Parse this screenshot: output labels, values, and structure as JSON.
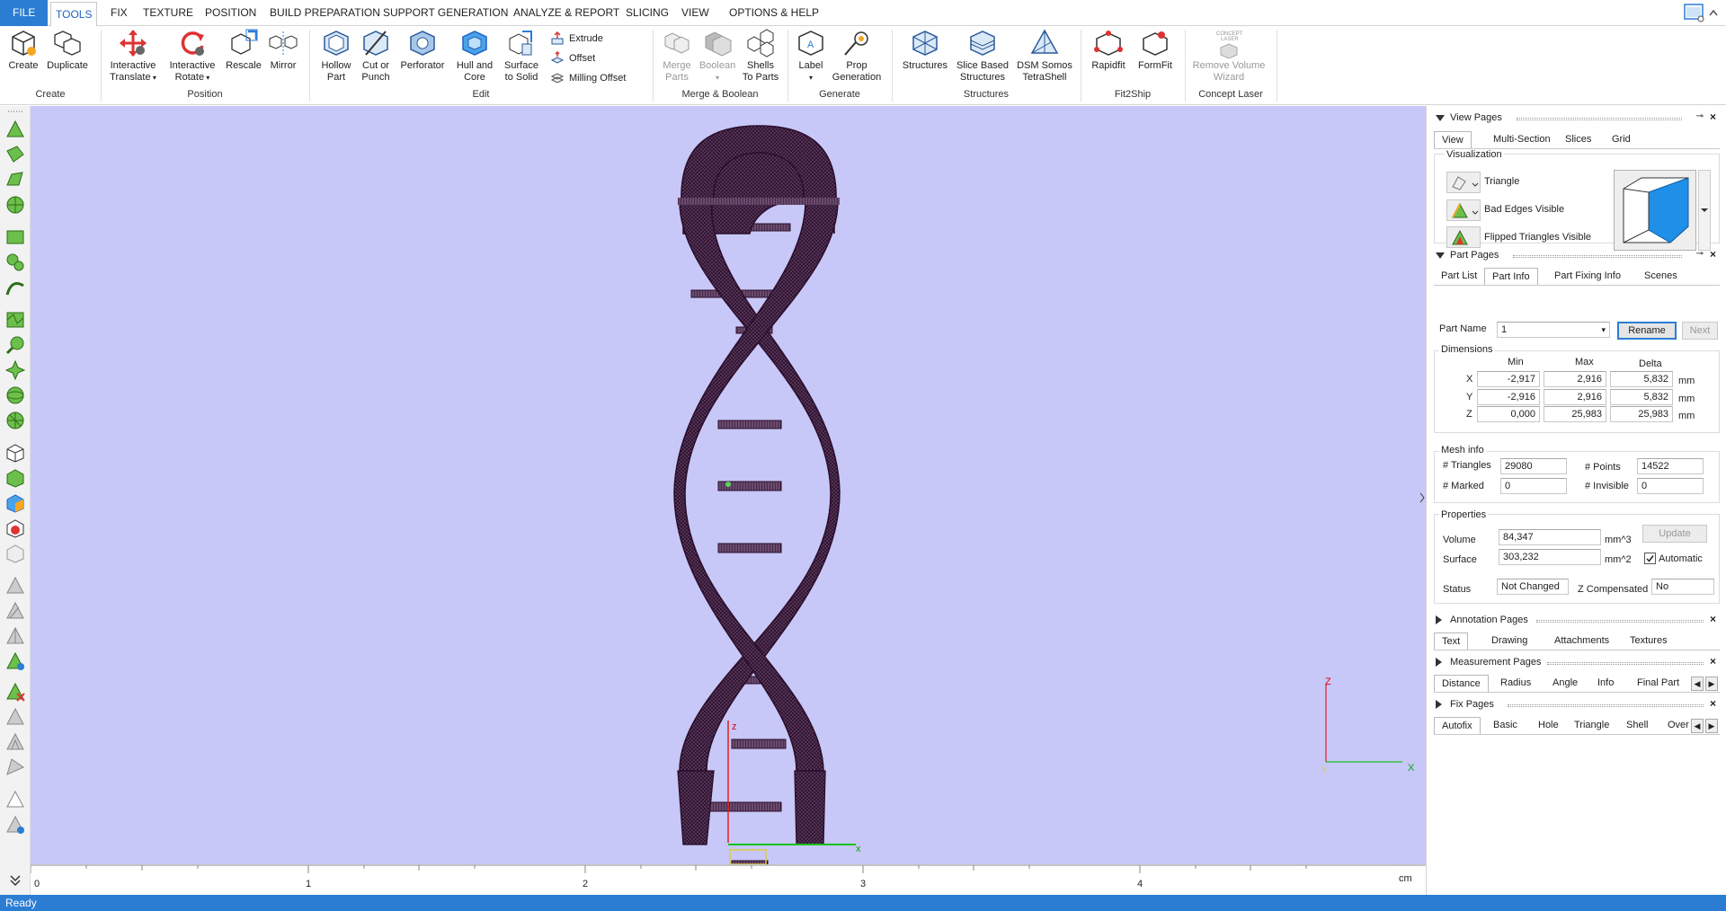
{
  "menu": {
    "file": "FILE",
    "tabs": [
      "TOOLS",
      "FIX",
      "TEXTURE",
      "POSITION",
      "BUILD PREPARATION",
      "SUPPORT GENERATION",
      "ANALYZE & REPORT",
      "SLICING",
      "VIEW",
      "OPTIONS & HELP"
    ],
    "active": "TOOLS"
  },
  "ribbon": {
    "create": {
      "label": "Create",
      "btn_create": "Create",
      "btn_duplicate": "Duplicate"
    },
    "position": {
      "label": "Position",
      "btn_translate_1": "Interactive",
      "btn_translate_2": "Translate",
      "btn_rotate_1": "Interactive",
      "btn_rotate_2": "Rotate",
      "btn_rescale": "Rescale",
      "btn_mirror": "Mirror"
    },
    "edit": {
      "label": "Edit",
      "btn_hollow_1": "Hollow",
      "btn_hollow_2": "Part",
      "btn_cut_1": "Cut or",
      "btn_cut_2": "Punch",
      "btn_perforator": "Perforator",
      "btn_hull_1": "Hull and",
      "btn_hull_2": "Core",
      "btn_surface_1": "Surface",
      "btn_surface_2": "to Solid",
      "btn_extrude": "Extrude",
      "btn_offset": "Offset",
      "btn_milling": "Milling Offset"
    },
    "merge": {
      "label": "Merge & Boolean",
      "btn_merge_1": "Merge",
      "btn_merge_2": "Parts",
      "btn_boolean": "Boolean",
      "btn_shells_1": "Shells",
      "btn_shells_2": "To Parts"
    },
    "generate": {
      "label": "Generate",
      "btn_label": "Label",
      "btn_prop_1": "Prop",
      "btn_prop_2": "Generation"
    },
    "structures": {
      "label": "Structures",
      "btn_structures": "Structures",
      "btn_slice_1": "Slice Based",
      "btn_slice_2": "Structures",
      "btn_dsm_1": "DSM Somos",
      "btn_dsm_2": "TetraShell"
    },
    "fit2ship": {
      "label": "Fit2Ship",
      "btn_rapidfit": "Rapidfit",
      "btn_formfit": "FormFit"
    },
    "concept": {
      "label": "Concept Laser",
      "btn_remove_1": "Remove Volume",
      "btn_remove_2": "Wizard",
      "logo_1": "CONCEPT",
      "logo_2": "LASER"
    }
  },
  "viewport": {
    "axis_z": "z",
    "axis_x": "x",
    "mini_z": "Z",
    "mini_x": "X",
    "mini_y": "Y"
  },
  "ruler": {
    "ticks": [
      "0",
      "1",
      "2",
      "3",
      "4"
    ],
    "unit": "cm"
  },
  "view_pages": {
    "title": "View Pages",
    "tabs": [
      "View",
      "Multi-Section",
      "Slices",
      "Grid"
    ],
    "selected": "View",
    "visualization": "Visualization",
    "items": [
      "Triangle",
      "Bad Edges Visible",
      "Flipped Triangles Visible"
    ]
  },
  "part_pages": {
    "title": "Part Pages",
    "tabs": [
      "Part List",
      "Part Info",
      "Part Fixing Info",
      "Scenes"
    ],
    "selected": "Part Info",
    "part_name_label": "Part Name",
    "part_name_value": "1",
    "rename": "Rename",
    "next": "Next",
    "dimensions_label": "Dimensions",
    "col_min": "Min",
    "col_max": "Max",
    "col_delta": "Delta",
    "rows": [
      {
        "axis": "X",
        "min": "-2,917",
        "max": "2,916",
        "delta": "5,832",
        "unit": "mm"
      },
      {
        "axis": "Y",
        "min": "-2,916",
        "max": "2,916",
        "delta": "5,832",
        "unit": "mm"
      },
      {
        "axis": "Z",
        "min": "0,000",
        "max": "25,983",
        "delta": "25,983",
        "unit": "mm"
      }
    ],
    "mesh_info_label": "Mesh info",
    "triangles_label": "# Triangles",
    "triangles": "29080",
    "points_label": "# Points",
    "points": "14522",
    "marked_label": "# Marked",
    "marked": "0",
    "invisible_label": "# Invisible",
    "invisible": "0",
    "properties_label": "Properties",
    "volume_label": "Volume",
    "volume": "84,347",
    "volume_unit": "mm^3",
    "surface_label": "Surface",
    "surface": "303,232",
    "surface_unit": "mm^2",
    "update": "Update",
    "automatic": "Automatic",
    "status_label": "Status",
    "status": "Not Changed",
    "zcomp_label": "Z Compensated",
    "zcomp": "No"
  },
  "annotation_pages": {
    "title": "Annotation Pages",
    "tabs": [
      "Text",
      "Drawing",
      "Attachments",
      "Textures"
    ],
    "selected": "Text"
  },
  "measurement_pages": {
    "title": "Measurement Pages",
    "tabs": [
      "Distance",
      "Radius",
      "Angle",
      "Info",
      "Final Part"
    ],
    "selected": "Distance"
  },
  "fix_pages": {
    "title": "Fix Pages",
    "tabs": [
      "Autofix",
      "Basic",
      "Hole",
      "Triangle",
      "Shell",
      "Over"
    ],
    "selected": "Autofix"
  },
  "status_bar": {
    "text": "Ready"
  },
  "colors": {
    "accent": "#2b7cd3",
    "viewport_bg": "#c8c8f8",
    "mesh": "#3a1a3c"
  }
}
